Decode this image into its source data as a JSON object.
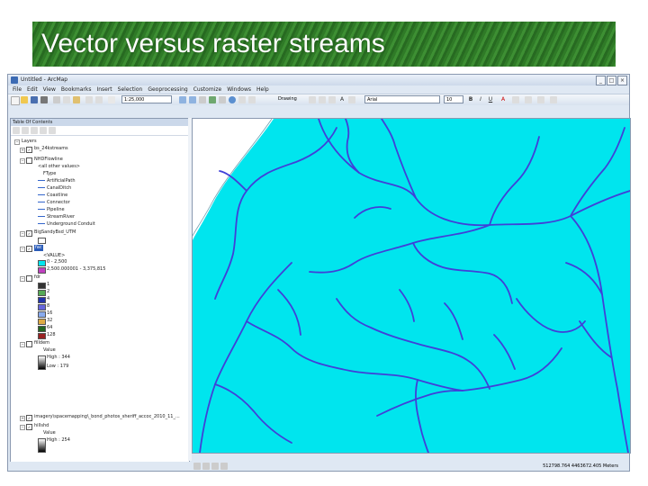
{
  "slide": {
    "title": "Vector versus raster streams"
  },
  "window": {
    "title": "Untitled - ArcMap",
    "controls": [
      "_",
      "□",
      "×"
    ]
  },
  "menu": [
    "File",
    "Edit",
    "View",
    "Bookmarks",
    "Insert",
    "Selection",
    "Geoprocessing",
    "Customize",
    "Windows",
    "Help"
  ],
  "toolbar": {
    "scale": "1:25,000",
    "drawing_label": "Drawing",
    "font_name": "Arial",
    "font_size": "10"
  },
  "toc": {
    "title": "Table Of Contents",
    "layers_label": "Layers",
    "layers": [
      {
        "name": "bs_24kstreams"
      },
      {
        "name": "NHDFlowline",
        "subtitle": "<all other values>",
        "field": "FType",
        "classes": [
          "ArtificialPath",
          "CanalDitch",
          "Coastline",
          "Connector",
          "Pipeline",
          "StreamRiver",
          "Underground Conduit"
        ]
      },
      {
        "name": "BigSandyBsd_UTM"
      },
      {
        "name": "fac",
        "field": "<VALUE>",
        "classes": [
          {
            "label": "0 - 2,500",
            "color": "#00e5ee"
          },
          {
            "label": "2,500.000001 - 3,375,815",
            "color": "#c040c0"
          }
        ]
      },
      {
        "name": "fdr",
        "classes": [
          {
            "label": "1",
            "color": "#333333"
          },
          {
            "label": "2",
            "color": "#55aa55"
          },
          {
            "label": "4",
            "color": "#2233aa"
          },
          {
            "label": "8",
            "color": "#6666dd"
          },
          {
            "label": "16",
            "color": "#88aaee"
          },
          {
            "label": "32",
            "color": "#ddaa44"
          },
          {
            "label": "64",
            "color": "#226622"
          },
          {
            "label": "128",
            "color": "#992222"
          }
        ]
      },
      {
        "name": "filldem",
        "field": "Value",
        "high": "High : 344",
        "low": "Low : 179"
      },
      {
        "name": "imagery\\spacemapping\\_bond_photos_sheriff_accoc_2010_11_..."
      },
      {
        "name": "hillshd",
        "field": "Value",
        "high": "High : 254"
      }
    ]
  },
  "status": {
    "coords": "512798.764  4463672.405 Meters"
  },
  "colors": {
    "raster_fill": "#00e5ee",
    "stream": "#4040d8",
    "title_bar": "#2f7a27"
  },
  "icons": [
    "app-icon",
    "new-icon",
    "open-icon",
    "save-icon",
    "print-icon",
    "zoom-in-icon",
    "zoom-out-icon",
    "pan-icon",
    "identify-icon",
    "bold-icon",
    "italic-icon",
    "underline-icon",
    "text-icon"
  ]
}
